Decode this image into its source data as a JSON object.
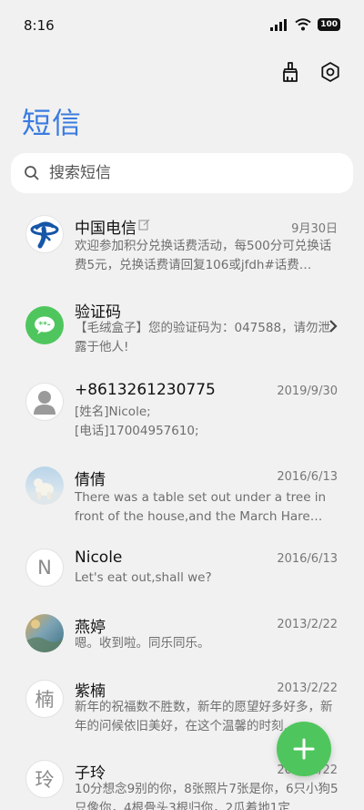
{
  "status_bar": {
    "time": "8:16",
    "battery": "100",
    "icons": [
      "signal-icon",
      "wifi-icon",
      "battery-icon"
    ]
  },
  "toolbar": {
    "icons": [
      "clean-brush-icon",
      "settings-hexagon-icon"
    ]
  },
  "page_title": "短信",
  "search": {
    "placeholder": "搜索短信",
    "icon": "search-icon"
  },
  "conversations": [
    {
      "name": "中国电信",
      "date": "9月30日",
      "preview": "欢迎参加积分兑换话费活动，每500分可兑换话费5元，兑换话费请回复106或jfdh#话费…",
      "avatar": "china-telecom-logo-icon",
      "name_badge": "edit-note-icon"
    },
    {
      "name": "验证码",
      "date": "",
      "preview": "【毛绒盒子】您的验证码为：047588，请勿泄露于他人!",
      "avatar": "verification-code-icon",
      "accent": "#4fc65d"
    },
    {
      "name": "+8613261230775",
      "date": "2019/9/30",
      "preview": "[姓名]Nicole;\n[电话]17004957610;",
      "avatar": "default-contact-icon"
    },
    {
      "name": "倩倩",
      "date": "2016/6/13",
      "preview": "There was a table set out under a tree in front of the house,and the March Hare an…",
      "avatar": "polar-bear-photo"
    },
    {
      "name": "Nicole",
      "date": "2016/6/13",
      "preview": "Let's eat out,shall we?",
      "avatar_letter": "N"
    },
    {
      "name": "燕婷",
      "date": "2013/2/22",
      "preview": "嗯。收到啦。同乐同乐。",
      "avatar": "landscape-photo"
    },
    {
      "name": "紫楠",
      "date": "2013/2/22",
      "preview": "新年的祝福数不胜数，新年的愿望好多好多，新年的问候依旧美好，在这个温馨的时刻…",
      "avatar_letter": "楠"
    },
    {
      "name": "子玲",
      "date": "2013/2/22",
      "preview": "10分想念9别的你，8张照片7张是你，6只小狗5只像你，4根骨头3根归你，2瓜着地1定…",
      "avatar_letter": "玲"
    }
  ],
  "fab": {
    "icon": "plus-icon",
    "color": "#4fc65d"
  },
  "colors": {
    "title": "#3a7be0",
    "background": "#f1f1f1",
    "fab": "#4fc65d"
  }
}
